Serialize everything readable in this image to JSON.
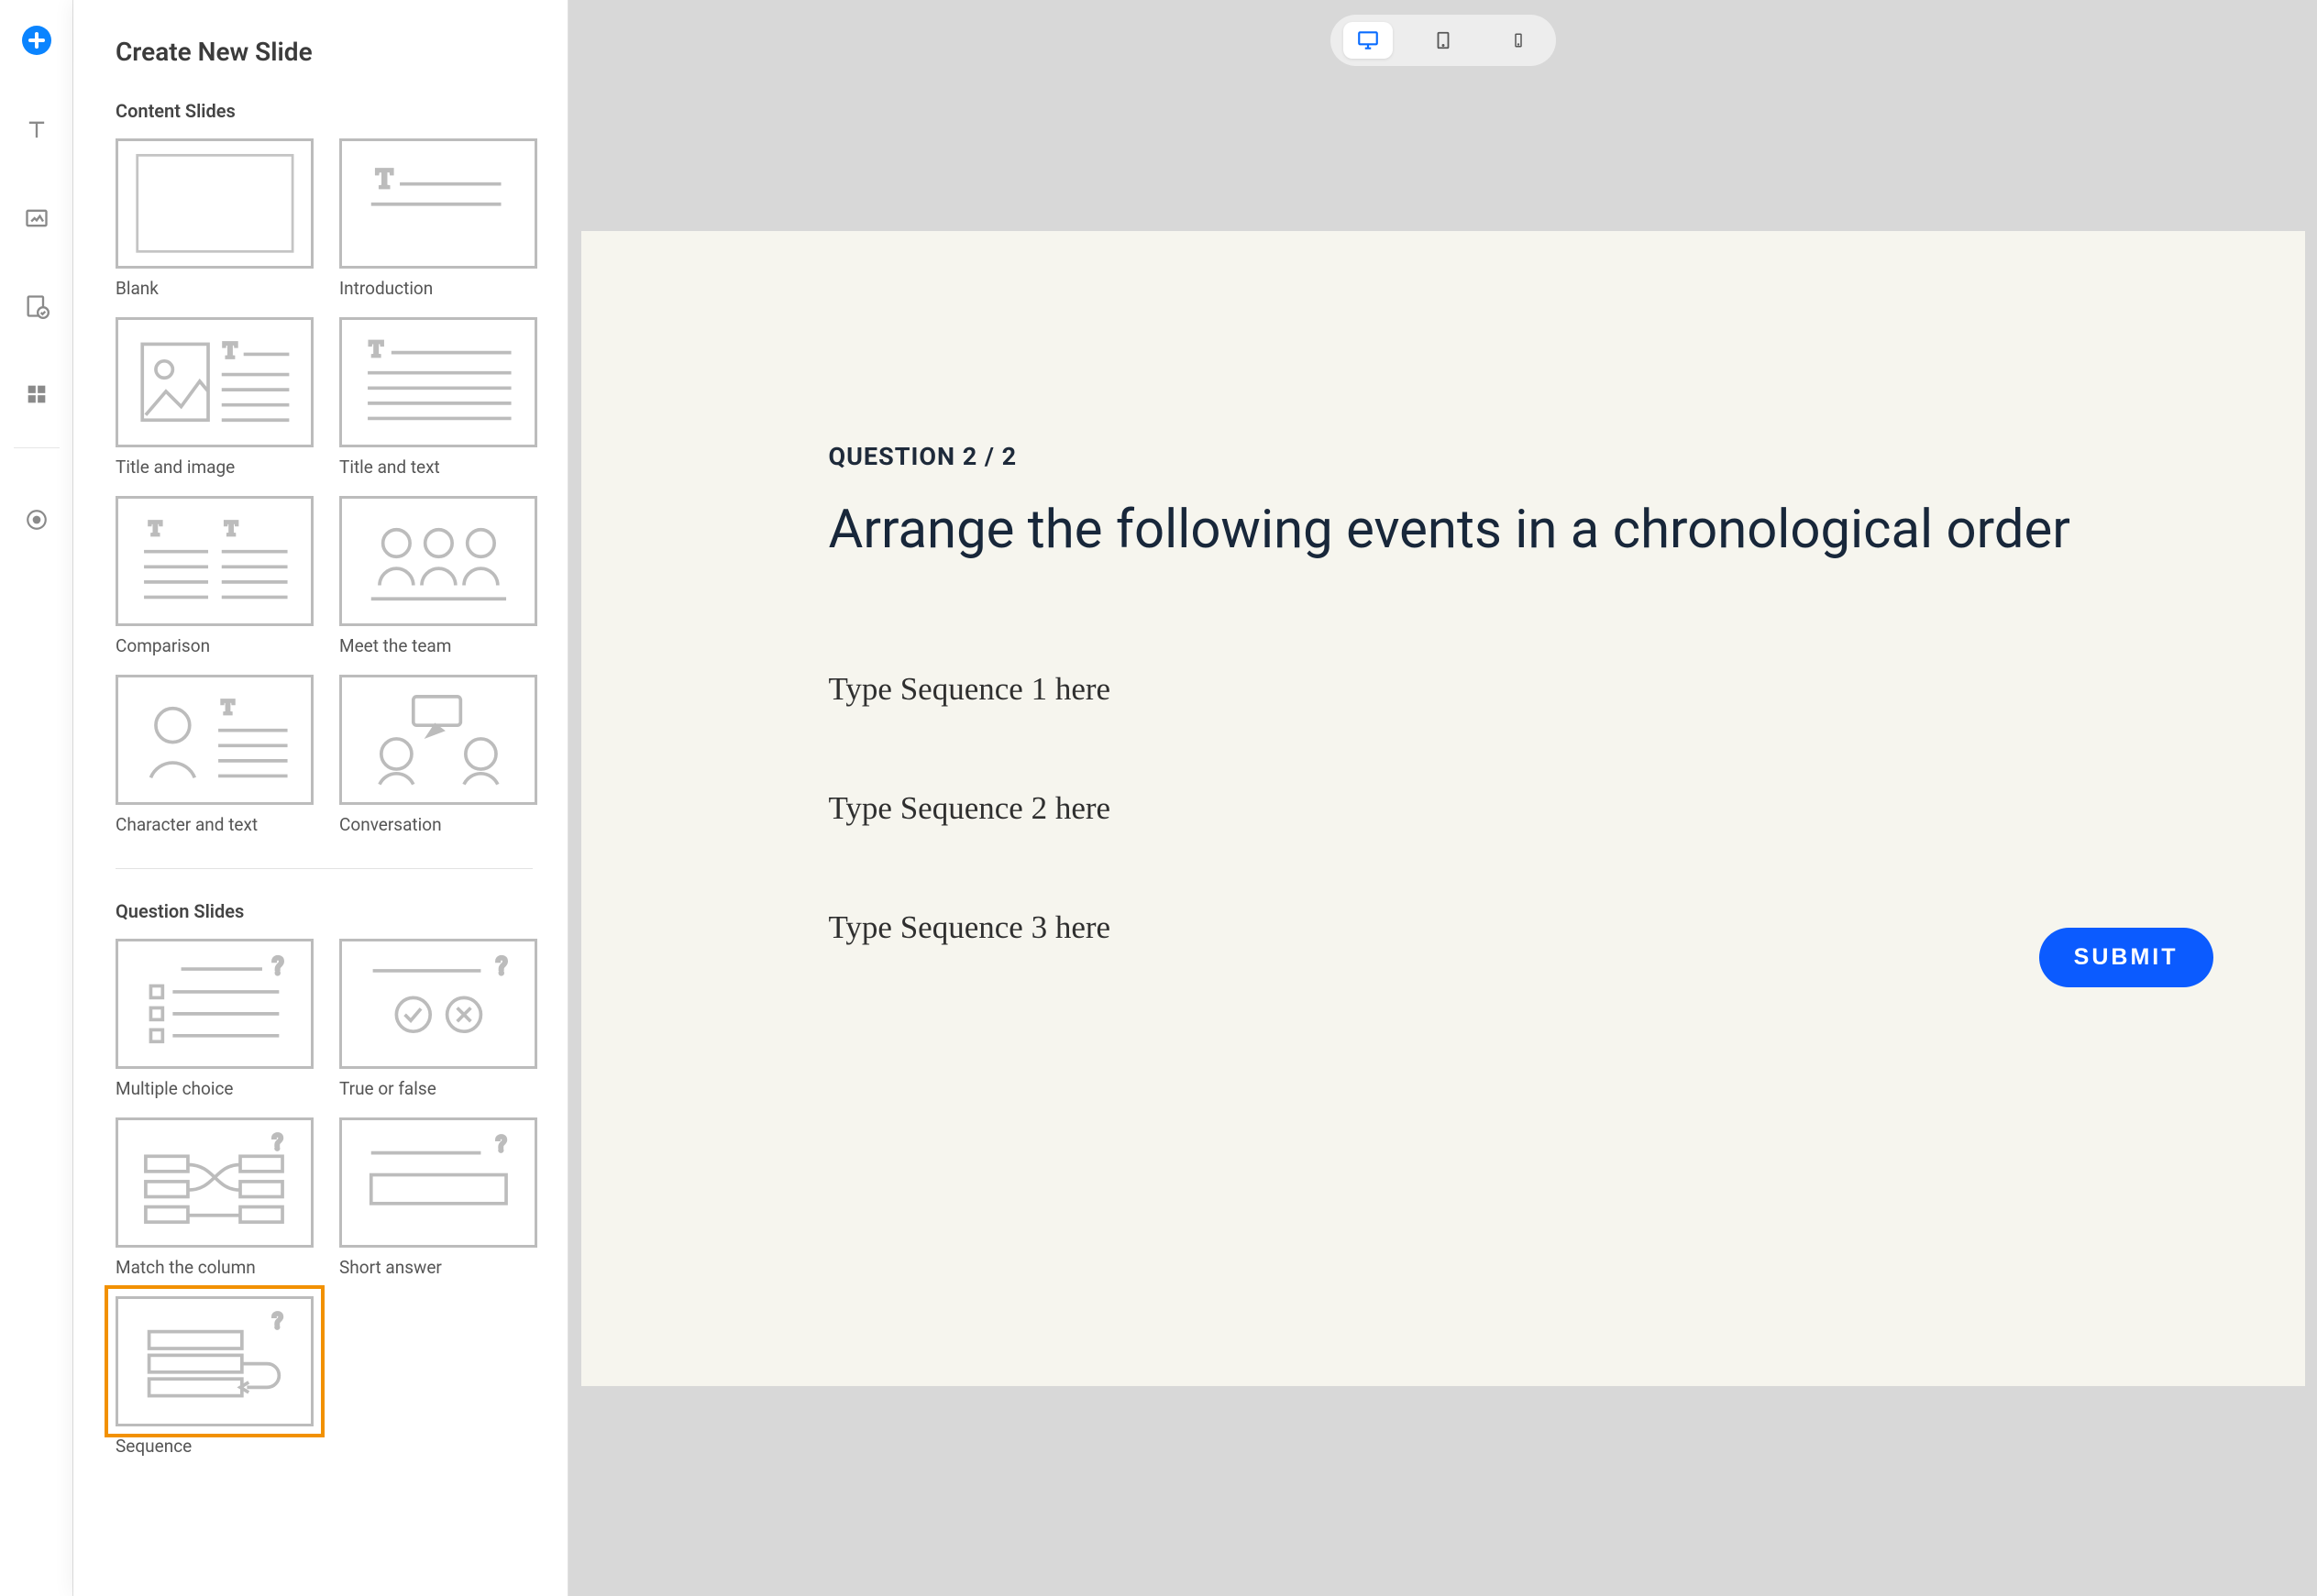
{
  "rail": {
    "icons": [
      "add",
      "text",
      "media",
      "quiz",
      "components",
      "record"
    ]
  },
  "panel": {
    "title": "Create New Slide",
    "section_content": "Content Slides",
    "section_question": "Question Slides",
    "content_tiles": [
      {
        "label": "Blank"
      },
      {
        "label": "Introduction"
      },
      {
        "label": "Title and image"
      },
      {
        "label": "Title and text"
      },
      {
        "label": "Comparison"
      },
      {
        "label": "Meet the team"
      },
      {
        "label": "Character and text"
      },
      {
        "label": "Conversation"
      }
    ],
    "question_tiles": [
      {
        "label": "Multiple choice"
      },
      {
        "label": "True or false"
      },
      {
        "label": "Match the column"
      },
      {
        "label": "Short answer"
      },
      {
        "label": "Sequence",
        "selected": true
      }
    ]
  },
  "device": {
    "active": "desktop"
  },
  "slide": {
    "question_label": "QUESTION 2 / 2",
    "title": "Arrange the following events in a chronological order",
    "sequences": [
      "Type Sequence 1 here",
      "Type Sequence 2 here",
      "Type Sequence 3 here"
    ],
    "submit_label": "SUBMIT"
  }
}
